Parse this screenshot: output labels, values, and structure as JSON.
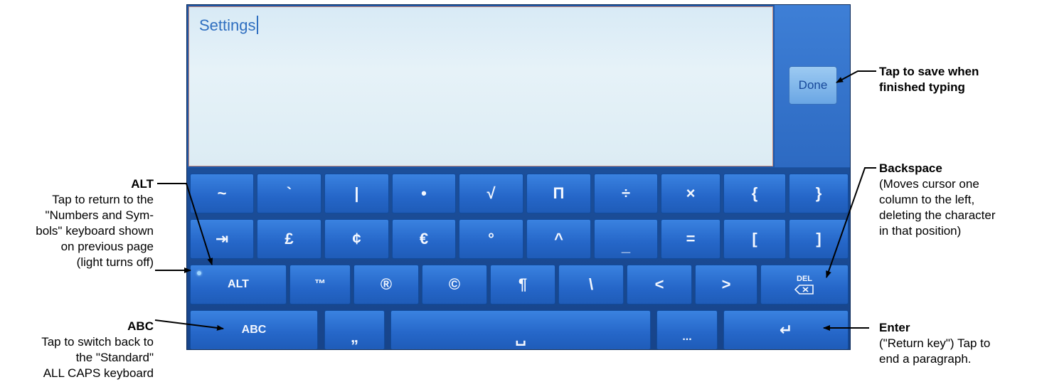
{
  "text_field": {
    "value": "Settings"
  },
  "done_button": {
    "label": "Done"
  },
  "rows": [
    [
      "~",
      "`",
      "|",
      "•",
      "√",
      "Π",
      "÷",
      "×",
      "{",
      "}"
    ],
    [
      "⇥",
      "£",
      "¢",
      "€",
      "°",
      "^",
      "_",
      "=",
      "[",
      "]"
    ],
    [
      "ALT",
      "™",
      "®",
      "©",
      "¶",
      "\\",
      "<",
      ">",
      "DEL"
    ],
    [
      "ABC",
      "„",
      "␣",
      "...",
      "↵"
    ]
  ],
  "callouts": {
    "alt": {
      "title": "ALT",
      "lines": [
        "Tap to return to the",
        "\"Numbers and Sym-",
        "bols\" keyboard shown",
        "on previous page",
        "(light turns off)"
      ]
    },
    "abc": {
      "title": "ABC",
      "lines": [
        "Tap to switch back to",
        "the \"Standard\"",
        "ALL CAPS keyboard"
      ]
    },
    "done": {
      "lines": [
        "Tap to save when",
        "finished typing"
      ]
    },
    "backspace": {
      "title": "Backspace",
      "lines": [
        "(Moves cursor one",
        "column to the left,",
        "deleting the character",
        "in that position)"
      ]
    },
    "enter": {
      "title": "Enter",
      "lines": [
        "(\"Return key\") Tap to",
        "end a paragraph."
      ]
    }
  }
}
